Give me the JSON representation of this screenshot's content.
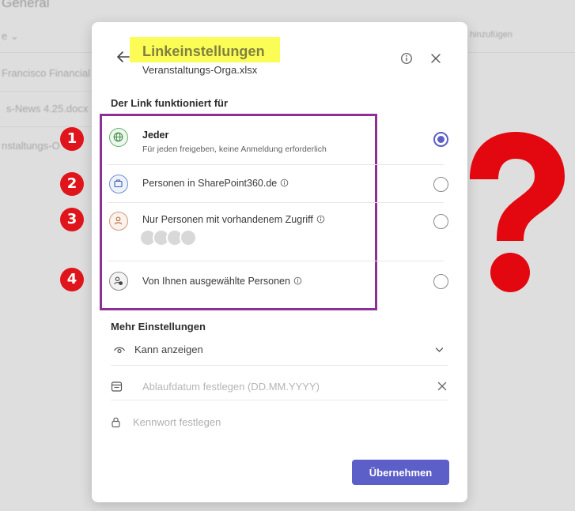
{
  "background": {
    "title": "General",
    "items": [
      {
        "label": "e ⌄"
      },
      {
        "label": "Francisco Financial"
      },
      {
        "label": "s-News 4.25.docx"
      },
      {
        "label": "nstaltungs-O"
      }
    ],
    "right_label": "hinzufügen"
  },
  "dialog": {
    "title": "Linkeinstellungen",
    "subtitle": "Veranstaltungs-Orga.xlsx",
    "section_link_works_for": "Der Link funktioniert für",
    "options": [
      {
        "label": "Jeder",
        "description": "Für jeden freigeben, keine Anmeldung erforderlich",
        "selected": true,
        "icon": "globe-icon",
        "marker": "1"
      },
      {
        "label": "Personen in SharePoint360.de",
        "selected": false,
        "icon": "building-icon",
        "marker": "2"
      },
      {
        "label": "Nur Personen mit vorhandenem Zugriff",
        "selected": false,
        "icon": "person-icon",
        "marker": "3"
      },
      {
        "label": "Von Ihnen ausgewählte Personen",
        "selected": false,
        "icon": "person-add-icon",
        "marker": "4"
      }
    ],
    "section_more_settings": "Mehr Einstellungen",
    "permission": "Kann anzeigen",
    "expiry_placeholder": "Ablaufdatum festlegen (DD.MM.YYYY)",
    "password_placeholder": "Kennwort festlegen",
    "apply_label": "Übernehmen"
  },
  "colors": {
    "accent": "#5b5fc7",
    "highlight": "#fcfc57",
    "frame": "#8d2f94",
    "marker": "#e0141b"
  }
}
